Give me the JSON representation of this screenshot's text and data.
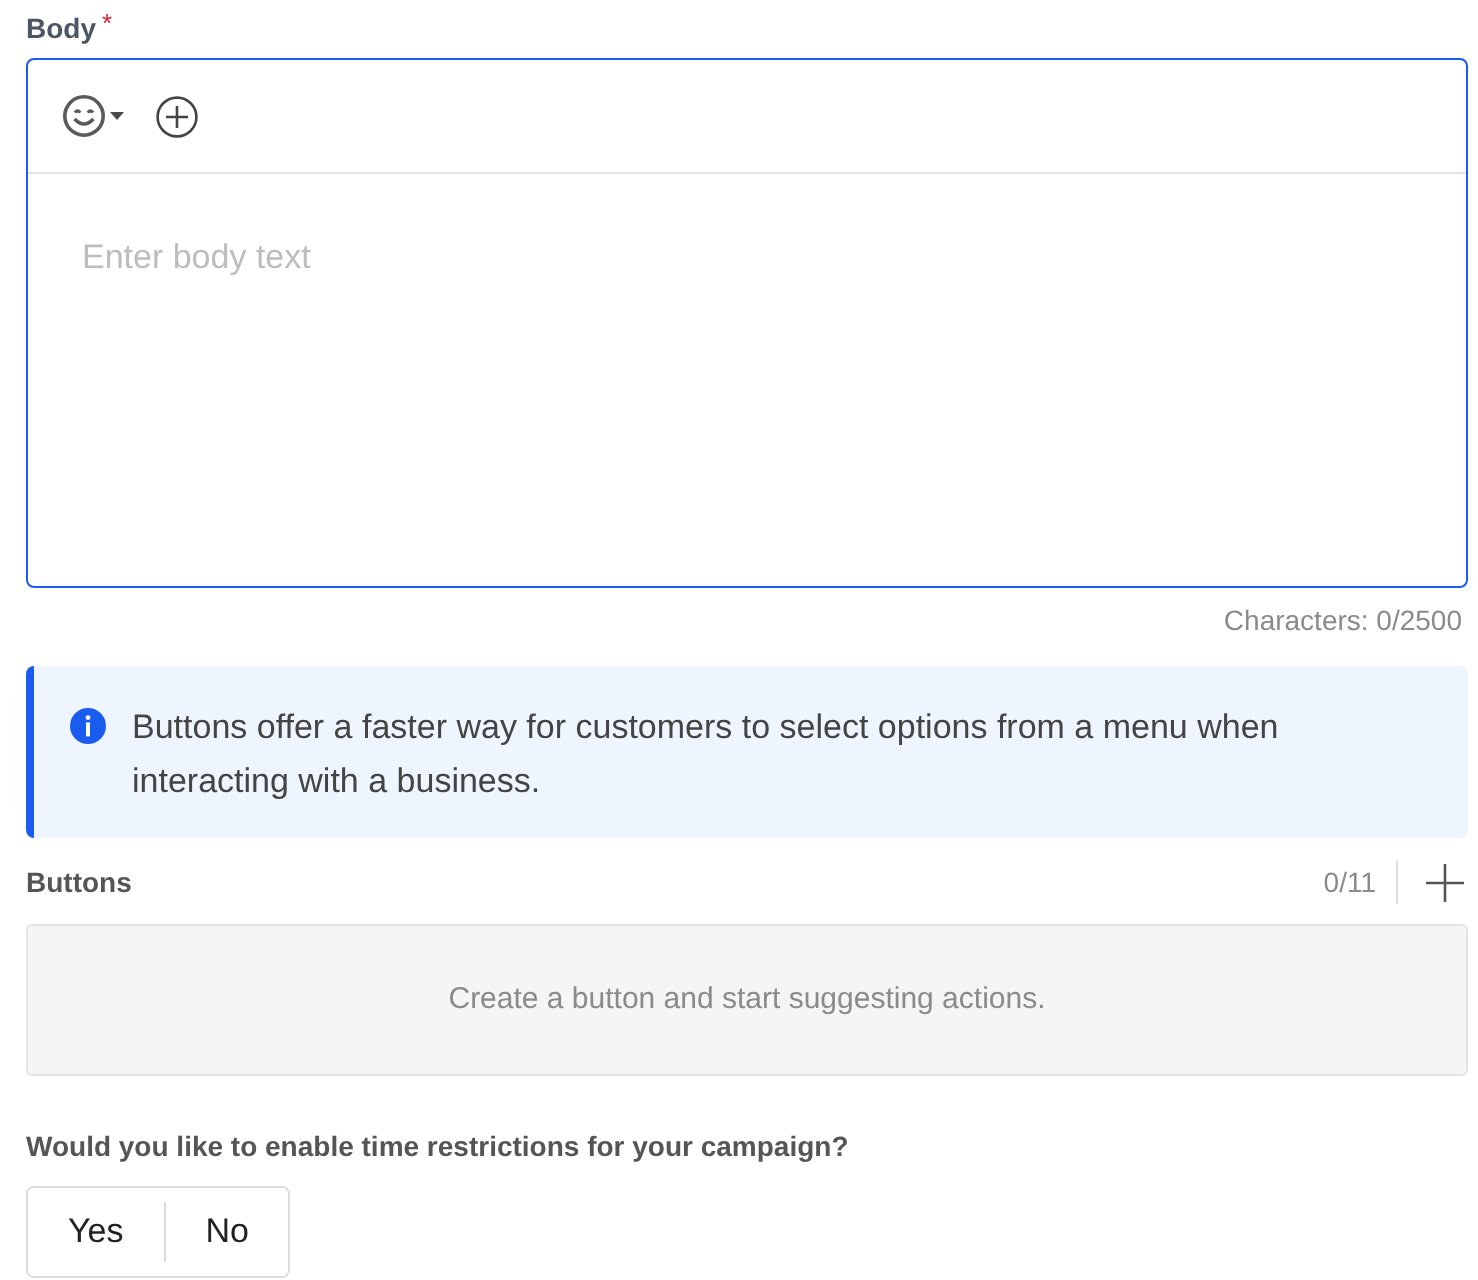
{
  "body": {
    "label": "Body",
    "required_mark": "*",
    "focused": true,
    "placeholder": "Enter body text",
    "counter": "Characters: 0/2500"
  },
  "info": {
    "text": "Buttons offer a faster way for customers to select options from a menu when interacting with a business."
  },
  "buttons": {
    "label": "Buttons",
    "count": "0/11",
    "empty_text": "Create a button and start suggesting actions."
  },
  "time_restriction": {
    "question": "Would you like to enable time restrictions for your campaign?",
    "options": [
      {
        "label": "Yes",
        "selected": false
      },
      {
        "label": "No",
        "selected": false
      }
    ]
  }
}
